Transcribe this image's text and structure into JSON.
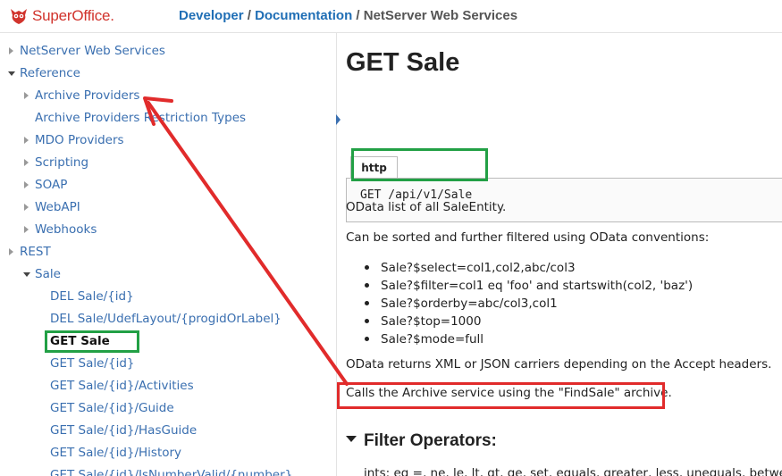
{
  "header": {
    "logo_text": "SuperOffice.",
    "breadcrumb": [
      "Developer",
      "Documentation"
    ],
    "breadcrumb_sep": "/",
    "breadcrumb_current": "NetServer Web Services"
  },
  "sidebar": {
    "items": [
      {
        "label": "NetServer Web Services"
      },
      {
        "label": "Reference"
      },
      {
        "label": "Archive Providers"
      },
      {
        "label": "Archive Providers Restriction Types"
      },
      {
        "label": "MDO Providers"
      },
      {
        "label": "Scripting"
      },
      {
        "label": "SOAP"
      },
      {
        "label": "WebAPI"
      },
      {
        "label": "Webhooks"
      },
      {
        "label": "REST"
      },
      {
        "label": "Sale"
      },
      {
        "label": "DEL Sale/{id}"
      },
      {
        "label": "DEL Sale/UdefLayout/{progidOrLabel}"
      },
      {
        "label": "GET Sale"
      },
      {
        "label": "GET Sale/{id}"
      },
      {
        "label": "GET Sale/{id}/Activities"
      },
      {
        "label": "GET Sale/{id}/Guide"
      },
      {
        "label": "GET Sale/{id}/HasGuide"
      },
      {
        "label": "GET Sale/{id}/History"
      },
      {
        "label": "GET Sale/{id}/IsNumberValid/{number}"
      }
    ]
  },
  "main": {
    "title": "GET Sale",
    "code_tab": "http",
    "code": "GET /api/v1/Sale",
    "p1": "OData list of all SaleEntity.",
    "p2": "Can be sorted and further filtered using OData conventions:",
    "bullets": [
      "Sale?$select=col1,col2,abc/col3",
      "Sale?$filter=col1 eq 'foo' and startswith(col2, 'baz')",
      "Sale?$orderby=abc/col3,col1",
      "Sale?$top=1000",
      "Sale?$mode=full"
    ],
    "p3": "OData returns XML or JSON carriers depending on the Accept headers.",
    "p4": "Calls the Archive service using the \"FindSale\" archive.",
    "section_heading": "Filter Operators:",
    "operators_text": "ints: eq =, ne, le, lt, gt, ge, set, equals, greater, less, unequals, between"
  },
  "colors": {
    "brand_red": "#d1342d",
    "link_blue": "#1f6eb5",
    "highlight_green": "#22a045",
    "highlight_red": "#e12b2b"
  }
}
